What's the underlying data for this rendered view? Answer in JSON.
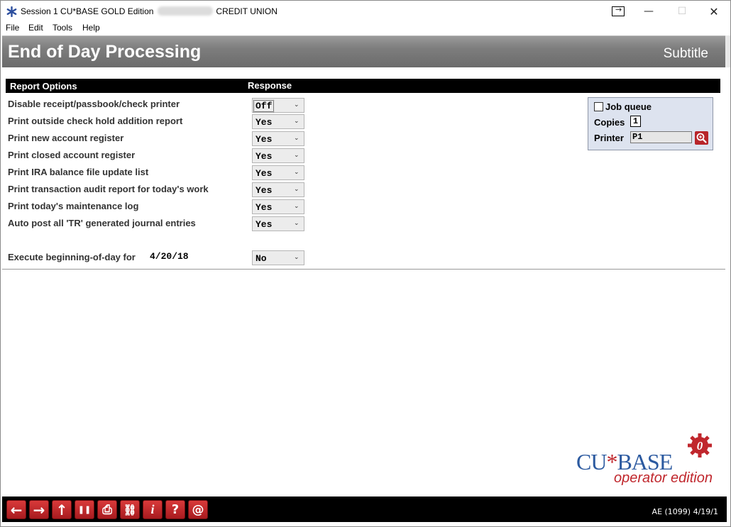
{
  "window": {
    "title_prefix": "Session 1 CU*BASE GOLD Edition",
    "title_suffix": "CREDIT UNION",
    "minimize_glyph": "—",
    "maximize_glyph": "☐",
    "close_glyph": "✕"
  },
  "menu": [
    "File",
    "Edit",
    "Tools",
    "Help"
  ],
  "header": {
    "title": "End of Day Processing",
    "subtitle": "Subtitle"
  },
  "table": {
    "col_options": "Report Options",
    "col_response": "Response",
    "rows": [
      {
        "label": "Disable receipt/passbook/check printer",
        "value": "Off"
      },
      {
        "label": "Print outside check hold addition report",
        "value": "Yes"
      },
      {
        "label": "Print new account register",
        "value": "Yes"
      },
      {
        "label": "Print closed account register",
        "value": "Yes"
      },
      {
        "label": "Print IRA balance file update list",
        "value": "Yes"
      },
      {
        "label": "Print transaction audit report for today's work",
        "value": "Yes"
      },
      {
        "label": "Print today's maintenance log",
        "value": "Yes"
      },
      {
        "label": "Auto post all 'TR' generated journal entries",
        "value": "Yes"
      }
    ],
    "bod": {
      "label": "Execute beginning-of-day for",
      "date": "4/20/18",
      "value": "No"
    }
  },
  "print_options": {
    "job_queue_label": "Job queue",
    "job_queue_checked": false,
    "copies_label": "Copies",
    "copies_value": "1",
    "printer_label": "Printer",
    "printer_value": "P1"
  },
  "logo": {
    "main_left": "CU",
    "main_star": "*",
    "main_right": "BASE",
    "sub": "operator edition",
    "gear_glyph": "0"
  },
  "toolbar": {
    "buttons": [
      {
        "name": "back-button",
        "icon": "arrow-left-icon",
        "glyph": "←"
      },
      {
        "name": "forward-button",
        "icon": "arrow-right-icon",
        "glyph": "→"
      },
      {
        "name": "up-button",
        "icon": "arrow-up-icon",
        "glyph": "↑"
      },
      {
        "name": "pause-button",
        "icon": "pause-icon",
        "glyph": "❚❚"
      },
      {
        "name": "print-button",
        "icon": "printer-icon",
        "glyph": "⎙"
      },
      {
        "name": "link-button",
        "icon": "link-icon",
        "glyph": "⛓"
      },
      {
        "name": "info-button",
        "icon": "info-icon",
        "glyph": "i"
      },
      {
        "name": "help-button",
        "icon": "question-icon",
        "glyph": "?"
      },
      {
        "name": "email-button",
        "icon": "at-icon",
        "glyph": "@"
      }
    ],
    "status": "AE (1099) 4/19/1"
  },
  "colors": {
    "accent_red": "#b8252a",
    "header_gray": "#7d7d7d",
    "logo_blue": "#2c5aa0"
  }
}
